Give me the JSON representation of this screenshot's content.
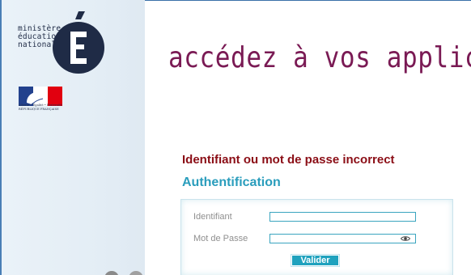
{
  "sidebar": {
    "logo_lines": [
      "ministère",
      "éducation",
      "nationale"
    ],
    "flag_caption": [
      "Liberté • Égalité • Fraternité",
      "RÉPUBLIQUE FRANÇAISE"
    ]
  },
  "main": {
    "tagline": "accédez à vos applications",
    "error_message": "Identifiant ou mot de passe incorrect",
    "auth_title": "Authentification"
  },
  "form": {
    "identifiant_label": "Identifiant",
    "identifiant_value": "",
    "password_label": "Mot de Passe",
    "password_value": "",
    "submit_label": "Valider"
  },
  "colors": {
    "tagline": "#7a1a54",
    "error": "#8b0e16",
    "accent": "#2a9dbc",
    "button": "#1fa2be",
    "sidebar_bg": "#e3edf5"
  },
  "icons": [
    "marianne-flag-logo",
    "education-e-logo",
    "eye-icon"
  ]
}
